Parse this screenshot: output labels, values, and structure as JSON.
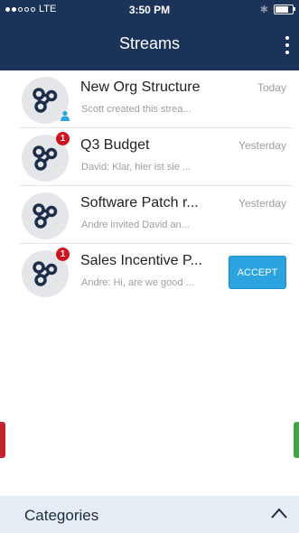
{
  "status_bar": {
    "carrier": "LTE",
    "time": "3:50 PM"
  },
  "header": {
    "title": "Streams"
  },
  "streams": [
    {
      "name": "New Org Structure",
      "preview": "Scott created this strea...",
      "time": "Today",
      "badge": "",
      "person_icon": true
    },
    {
      "name": "Q3 Budget",
      "preview": "David: Klar, hier ist sie ...",
      "time": "Yesterday",
      "badge": "1"
    },
    {
      "name": "Software Patch r...",
      "preview": "Andre invited David an...",
      "time": "Yesterday",
      "badge": ""
    },
    {
      "name": "Sales Incentive P...",
      "preview": "Andre: Hi, are we good ...",
      "time": "",
      "badge": "1",
      "action": "ACCEPT"
    }
  ],
  "footer": {
    "title": "Categories"
  },
  "colors": {
    "header": "#1c3359",
    "accent": "#2aa3e0",
    "badge": "#d0111f",
    "left_handle": "#c4222e",
    "right_handle": "#3ea540"
  },
  "icons": {
    "stream": "stream-network-icon",
    "menu": "more-vertical-icon",
    "chevron": "chevron-up-icon"
  }
}
